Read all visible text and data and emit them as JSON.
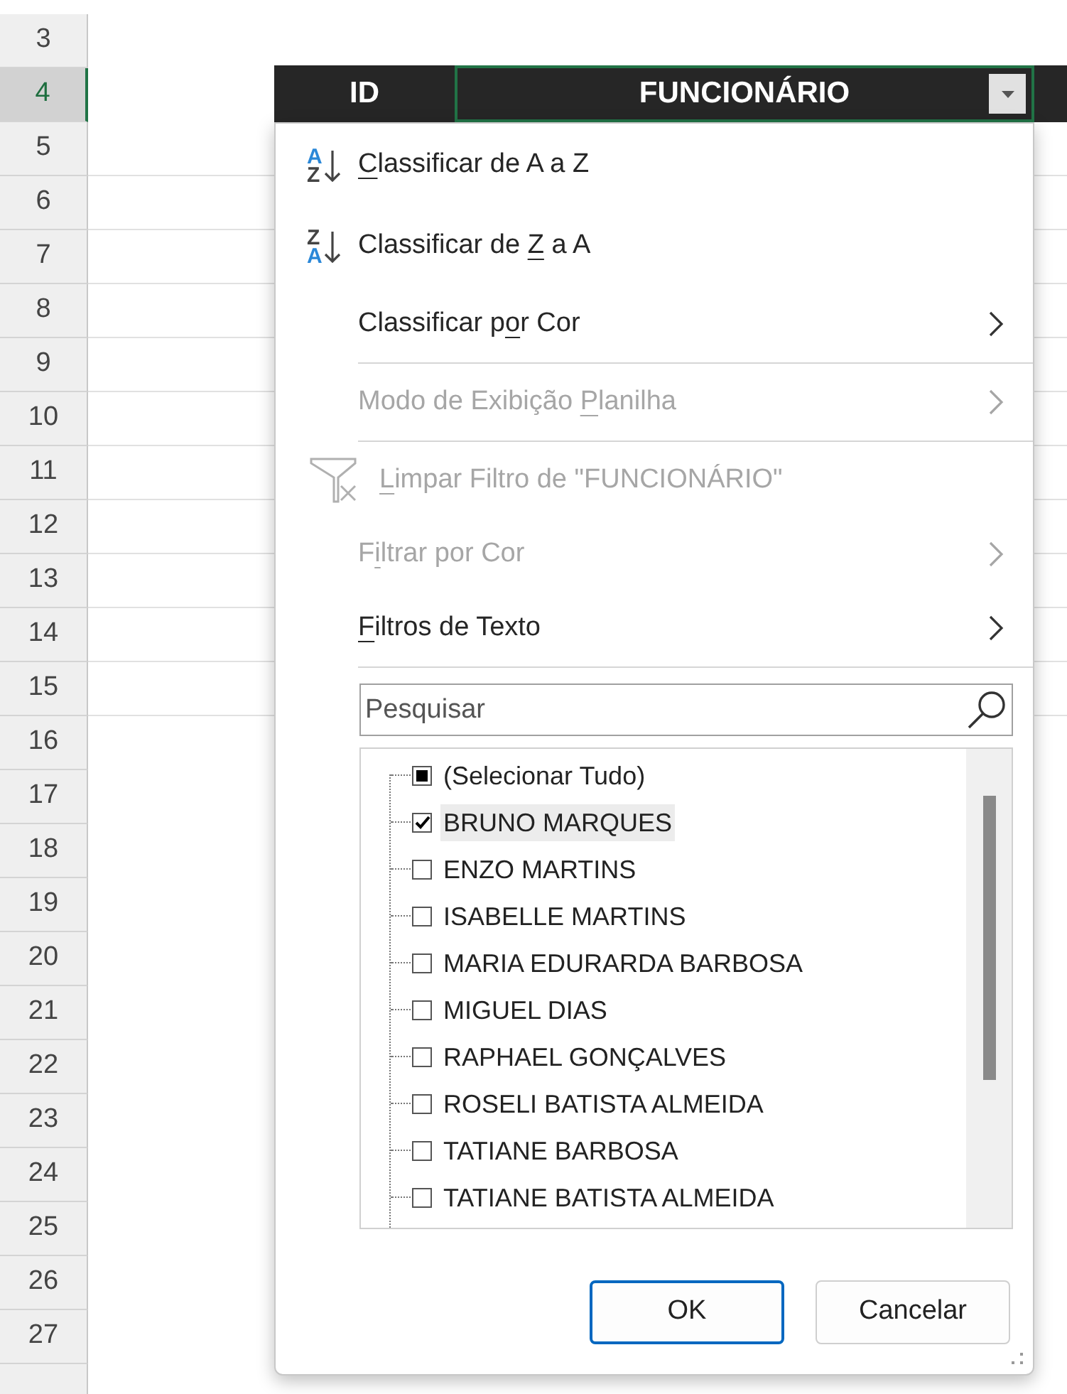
{
  "sheet": {
    "row_numbers": [
      {
        "label": "3",
        "selected": false
      },
      {
        "label": "4",
        "selected": true
      },
      {
        "label": "5",
        "selected": false
      },
      {
        "label": "6",
        "selected": false
      },
      {
        "label": "7",
        "selected": false
      },
      {
        "label": "8",
        "selected": false
      },
      {
        "label": "9",
        "selected": false
      },
      {
        "label": "10",
        "selected": false
      },
      {
        "label": "11",
        "selected": false
      },
      {
        "label": "12",
        "selected": false
      },
      {
        "label": "13",
        "selected": false
      },
      {
        "label": "14",
        "selected": false
      },
      {
        "label": "15",
        "selected": false
      },
      {
        "label": "16",
        "selected": false
      },
      {
        "label": "17",
        "selected": false
      },
      {
        "label": "18",
        "selected": false
      },
      {
        "label": "19",
        "selected": false
      },
      {
        "label": "20",
        "selected": false
      },
      {
        "label": "21",
        "selected": false
      },
      {
        "label": "22",
        "selected": false
      },
      {
        "label": "23",
        "selected": false
      },
      {
        "label": "24",
        "selected": false
      },
      {
        "label": "25",
        "selected": false
      },
      {
        "label": "26",
        "selected": false
      },
      {
        "label": "27",
        "selected": false
      }
    ]
  },
  "table": {
    "columns": [
      {
        "label": "ID",
        "selected": false
      },
      {
        "label": "FUNCIONÁRIO",
        "selected": true
      }
    ]
  },
  "filter_menu": {
    "items": [
      {
        "kind": "sort-asc",
        "icon_top": "A",
        "icon_bottom": "Z",
        "key": "C",
        "post": "lassificar de A a Z",
        "disabled": false
      },
      {
        "kind": "sort-desc",
        "icon_top": "Z",
        "icon_bottom": "A",
        "pre": "Classificar de ",
        "key": "Z",
        "post": " a A",
        "disabled": false
      },
      {
        "kind": "submenu",
        "pre": "Classificar p",
        "key": "o",
        "post": "r Cor",
        "disabled": false
      },
      {
        "kind": "separator"
      },
      {
        "kind": "submenu",
        "pre": "Modo de Exibição ",
        "key": "P",
        "post": "lanilha",
        "disabled": true
      },
      {
        "kind": "separator"
      },
      {
        "kind": "clear",
        "key": "L",
        "post": "impar Filtro de \"FUNCIONÁRIO\"",
        "disabled": true
      },
      {
        "kind": "submenu",
        "pre": "F",
        "key": "i",
        "post": "ltrar por Cor",
        "disabled": true
      },
      {
        "kind": "submenu",
        "key": "F",
        "post": "iltros de Texto",
        "disabled": false
      },
      {
        "kind": "separator"
      }
    ],
    "search": {
      "placeholder": "Pesquisar"
    },
    "values": [
      {
        "label": "(Selecionar Tudo)",
        "checked": false,
        "partial": true,
        "highlighted": false
      },
      {
        "label": "BRUNO MARQUES",
        "checked": true,
        "highlighted": true
      },
      {
        "label": "ENZO MARTINS",
        "checked": false,
        "highlighted": false
      },
      {
        "label": "ISABELLE MARTINS",
        "checked": false,
        "highlighted": false
      },
      {
        "label": "MARIA EDURARDA BARBOSA",
        "checked": false,
        "highlighted": false
      },
      {
        "label": "MIGUEL DIAS",
        "checked": false,
        "highlighted": false
      },
      {
        "label": "RAPHAEL GONÇALVES",
        "checked": false,
        "highlighted": false
      },
      {
        "label": "ROSELI BATISTA ALMEIDA",
        "checked": false,
        "highlighted": false
      },
      {
        "label": "TATIANE BARBOSA",
        "checked": false,
        "highlighted": false
      },
      {
        "label": "TATIANE BATISTA ALMEIDA",
        "checked": false,
        "highlighted": false
      }
    ],
    "buttons": [
      {
        "label": "OK",
        "default": true
      },
      {
        "label": "Cancelar",
        "default": false
      }
    ]
  }
}
